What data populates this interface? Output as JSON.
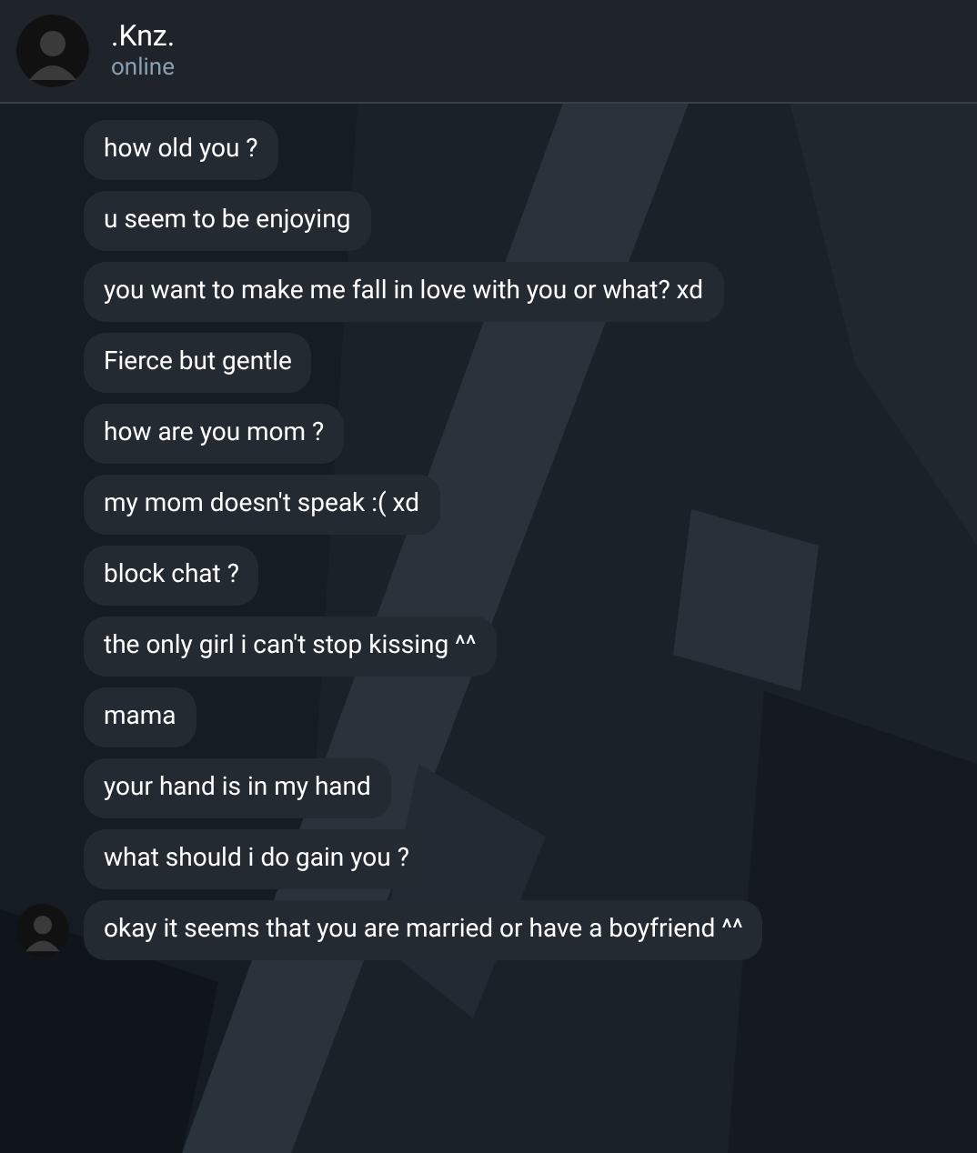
{
  "header": {
    "name": ".Knz.",
    "status": "online"
  },
  "messages": [
    {
      "text": "how old you ?",
      "show_avatar": false
    },
    {
      "text": "u seem to be enjoying",
      "show_avatar": false
    },
    {
      "text": "you want to make me fall in love with you or what? xd",
      "show_avatar": false
    },
    {
      "text": "Fierce but gentle",
      "show_avatar": false
    },
    {
      "text": "how are you mom ?",
      "show_avatar": false
    },
    {
      "text": "my mom doesn't speak :( xd",
      "show_avatar": false
    },
    {
      "text": "block chat ?",
      "show_avatar": false
    },
    {
      "text": "the only girl i can't stop kissing ^^",
      "show_avatar": false
    },
    {
      "text": "mama",
      "show_avatar": false
    },
    {
      "text": "your hand is in my hand",
      "show_avatar": false
    },
    {
      "text": "what should i do gain you ?",
      "show_avatar": false
    },
    {
      "text": "okay it seems that you are married or have a boyfriend ^^",
      "show_avatar": true
    }
  ]
}
